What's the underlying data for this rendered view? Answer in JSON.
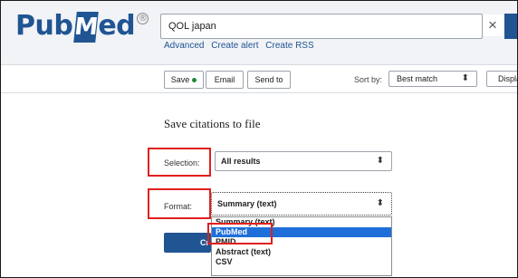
{
  "header": {
    "logo": {
      "part1": "Pub",
      "m_letter": "M",
      "part2": "ed",
      "reg": "®"
    },
    "search": {
      "value": "QOL japan",
      "placeholder": ""
    },
    "clear_icon": "×",
    "links": [
      "Advanced",
      "Create alert",
      "Create RSS"
    ]
  },
  "toolbar": {
    "save_label": "Save",
    "email_label": "Email",
    "send_label": "Send to",
    "sort_label": "Sort by:",
    "sort_value": "Best match",
    "display_label": "Displa"
  },
  "panel": {
    "title": "Save citations to file",
    "selection_label": "Selection:",
    "selection_value": "All results",
    "format_label": "Format:",
    "format_value": "Summary (text)",
    "format_options": [
      "Summary (text)",
      "PubMed",
      "PMID",
      "Abstract (text)",
      "CSV"
    ],
    "selected_option_index": 1,
    "create_label": "Cr"
  },
  "colors": {
    "brand": "#205493",
    "highlight": "#e0201e",
    "option_selected": "#1e6fd9",
    "status_dot": "#20883b"
  },
  "icons": [
    "search-icon",
    "clear-icon",
    "sort-arrows-icon"
  ]
}
